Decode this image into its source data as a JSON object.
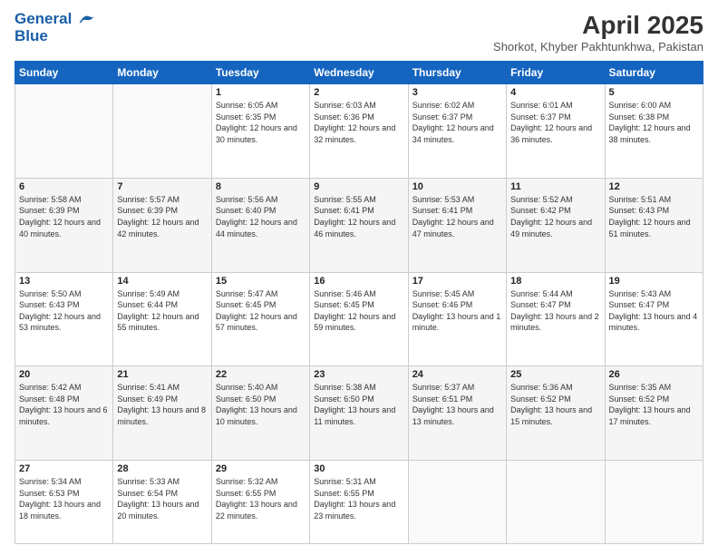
{
  "logo": {
    "line1": "General",
    "line2": "Blue"
  },
  "title": "April 2025",
  "subtitle": "Shorkot, Khyber Pakhtunkhwa, Pakistan",
  "weekdays": [
    "Sunday",
    "Monday",
    "Tuesday",
    "Wednesday",
    "Thursday",
    "Friday",
    "Saturday"
  ],
  "weeks": [
    [
      {
        "day": "",
        "info": ""
      },
      {
        "day": "",
        "info": ""
      },
      {
        "day": "1",
        "info": "Sunrise: 6:05 AM\nSunset: 6:35 PM\nDaylight: 12 hours and 30 minutes."
      },
      {
        "day": "2",
        "info": "Sunrise: 6:03 AM\nSunset: 6:36 PM\nDaylight: 12 hours and 32 minutes."
      },
      {
        "day": "3",
        "info": "Sunrise: 6:02 AM\nSunset: 6:37 PM\nDaylight: 12 hours and 34 minutes."
      },
      {
        "day": "4",
        "info": "Sunrise: 6:01 AM\nSunset: 6:37 PM\nDaylight: 12 hours and 36 minutes."
      },
      {
        "day": "5",
        "info": "Sunrise: 6:00 AM\nSunset: 6:38 PM\nDaylight: 12 hours and 38 minutes."
      }
    ],
    [
      {
        "day": "6",
        "info": "Sunrise: 5:58 AM\nSunset: 6:39 PM\nDaylight: 12 hours and 40 minutes."
      },
      {
        "day": "7",
        "info": "Sunrise: 5:57 AM\nSunset: 6:39 PM\nDaylight: 12 hours and 42 minutes."
      },
      {
        "day": "8",
        "info": "Sunrise: 5:56 AM\nSunset: 6:40 PM\nDaylight: 12 hours and 44 minutes."
      },
      {
        "day": "9",
        "info": "Sunrise: 5:55 AM\nSunset: 6:41 PM\nDaylight: 12 hours and 46 minutes."
      },
      {
        "day": "10",
        "info": "Sunrise: 5:53 AM\nSunset: 6:41 PM\nDaylight: 12 hours and 47 minutes."
      },
      {
        "day": "11",
        "info": "Sunrise: 5:52 AM\nSunset: 6:42 PM\nDaylight: 12 hours and 49 minutes."
      },
      {
        "day": "12",
        "info": "Sunrise: 5:51 AM\nSunset: 6:43 PM\nDaylight: 12 hours and 51 minutes."
      }
    ],
    [
      {
        "day": "13",
        "info": "Sunrise: 5:50 AM\nSunset: 6:43 PM\nDaylight: 12 hours and 53 minutes."
      },
      {
        "day": "14",
        "info": "Sunrise: 5:49 AM\nSunset: 6:44 PM\nDaylight: 12 hours and 55 minutes."
      },
      {
        "day": "15",
        "info": "Sunrise: 5:47 AM\nSunset: 6:45 PM\nDaylight: 12 hours and 57 minutes."
      },
      {
        "day": "16",
        "info": "Sunrise: 5:46 AM\nSunset: 6:45 PM\nDaylight: 12 hours and 59 minutes."
      },
      {
        "day": "17",
        "info": "Sunrise: 5:45 AM\nSunset: 6:46 PM\nDaylight: 13 hours and 1 minute."
      },
      {
        "day": "18",
        "info": "Sunrise: 5:44 AM\nSunset: 6:47 PM\nDaylight: 13 hours and 2 minutes."
      },
      {
        "day": "19",
        "info": "Sunrise: 5:43 AM\nSunset: 6:47 PM\nDaylight: 13 hours and 4 minutes."
      }
    ],
    [
      {
        "day": "20",
        "info": "Sunrise: 5:42 AM\nSunset: 6:48 PM\nDaylight: 13 hours and 6 minutes."
      },
      {
        "day": "21",
        "info": "Sunrise: 5:41 AM\nSunset: 6:49 PM\nDaylight: 13 hours and 8 minutes."
      },
      {
        "day": "22",
        "info": "Sunrise: 5:40 AM\nSunset: 6:50 PM\nDaylight: 13 hours and 10 minutes."
      },
      {
        "day": "23",
        "info": "Sunrise: 5:38 AM\nSunset: 6:50 PM\nDaylight: 13 hours and 11 minutes."
      },
      {
        "day": "24",
        "info": "Sunrise: 5:37 AM\nSunset: 6:51 PM\nDaylight: 13 hours and 13 minutes."
      },
      {
        "day": "25",
        "info": "Sunrise: 5:36 AM\nSunset: 6:52 PM\nDaylight: 13 hours and 15 minutes."
      },
      {
        "day": "26",
        "info": "Sunrise: 5:35 AM\nSunset: 6:52 PM\nDaylight: 13 hours and 17 minutes."
      }
    ],
    [
      {
        "day": "27",
        "info": "Sunrise: 5:34 AM\nSunset: 6:53 PM\nDaylight: 13 hours and 18 minutes."
      },
      {
        "day": "28",
        "info": "Sunrise: 5:33 AM\nSunset: 6:54 PM\nDaylight: 13 hours and 20 minutes."
      },
      {
        "day": "29",
        "info": "Sunrise: 5:32 AM\nSunset: 6:55 PM\nDaylight: 13 hours and 22 minutes."
      },
      {
        "day": "30",
        "info": "Sunrise: 5:31 AM\nSunset: 6:55 PM\nDaylight: 13 hours and 23 minutes."
      },
      {
        "day": "",
        "info": ""
      },
      {
        "day": "",
        "info": ""
      },
      {
        "day": "",
        "info": ""
      }
    ]
  ]
}
